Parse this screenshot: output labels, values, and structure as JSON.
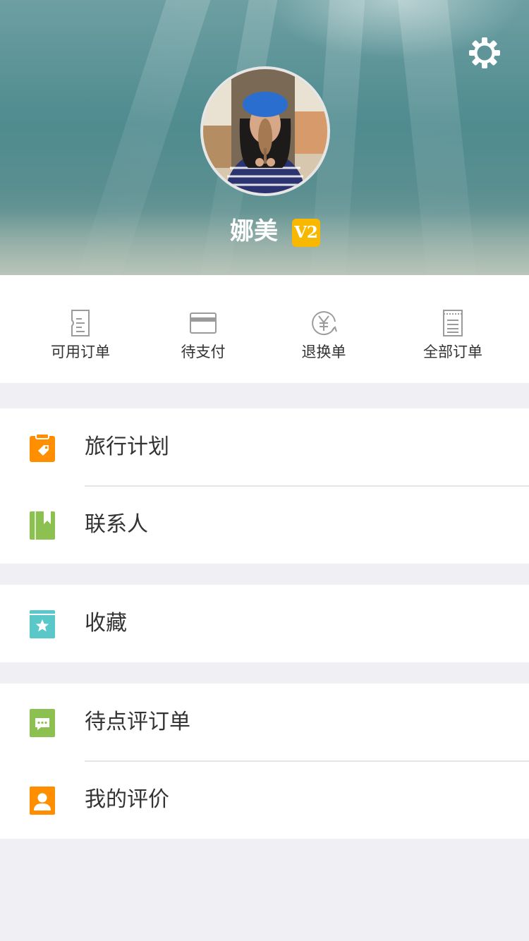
{
  "profile": {
    "username": "娜美",
    "level_badge": "V2"
  },
  "icons": {
    "settings": "gear-icon"
  },
  "orders": [
    {
      "label": "可用订单",
      "icon": "ticket-icon"
    },
    {
      "label": "待支付",
      "icon": "card-icon"
    },
    {
      "label": "退换单",
      "icon": "yen-refund-icon"
    },
    {
      "label": "全部订单",
      "icon": "document-list-icon"
    }
  ],
  "menu": {
    "travel_plan": {
      "label": "旅行计划",
      "icon": "clipboard-tag-icon",
      "color": "#ff8f00"
    },
    "contacts": {
      "label": "联系人",
      "icon": "book-bookmark-icon",
      "color": "#8cc152"
    },
    "favorites": {
      "label": "收藏",
      "icon": "star-box-icon",
      "color": "#5ac8c8"
    },
    "pending_review": {
      "label": "待点评订单",
      "icon": "chat-bubble-icon",
      "color": "#8cc152"
    },
    "my_reviews": {
      "label": "我的评价",
      "icon": "person-icon",
      "color": "#ff8f00"
    }
  }
}
